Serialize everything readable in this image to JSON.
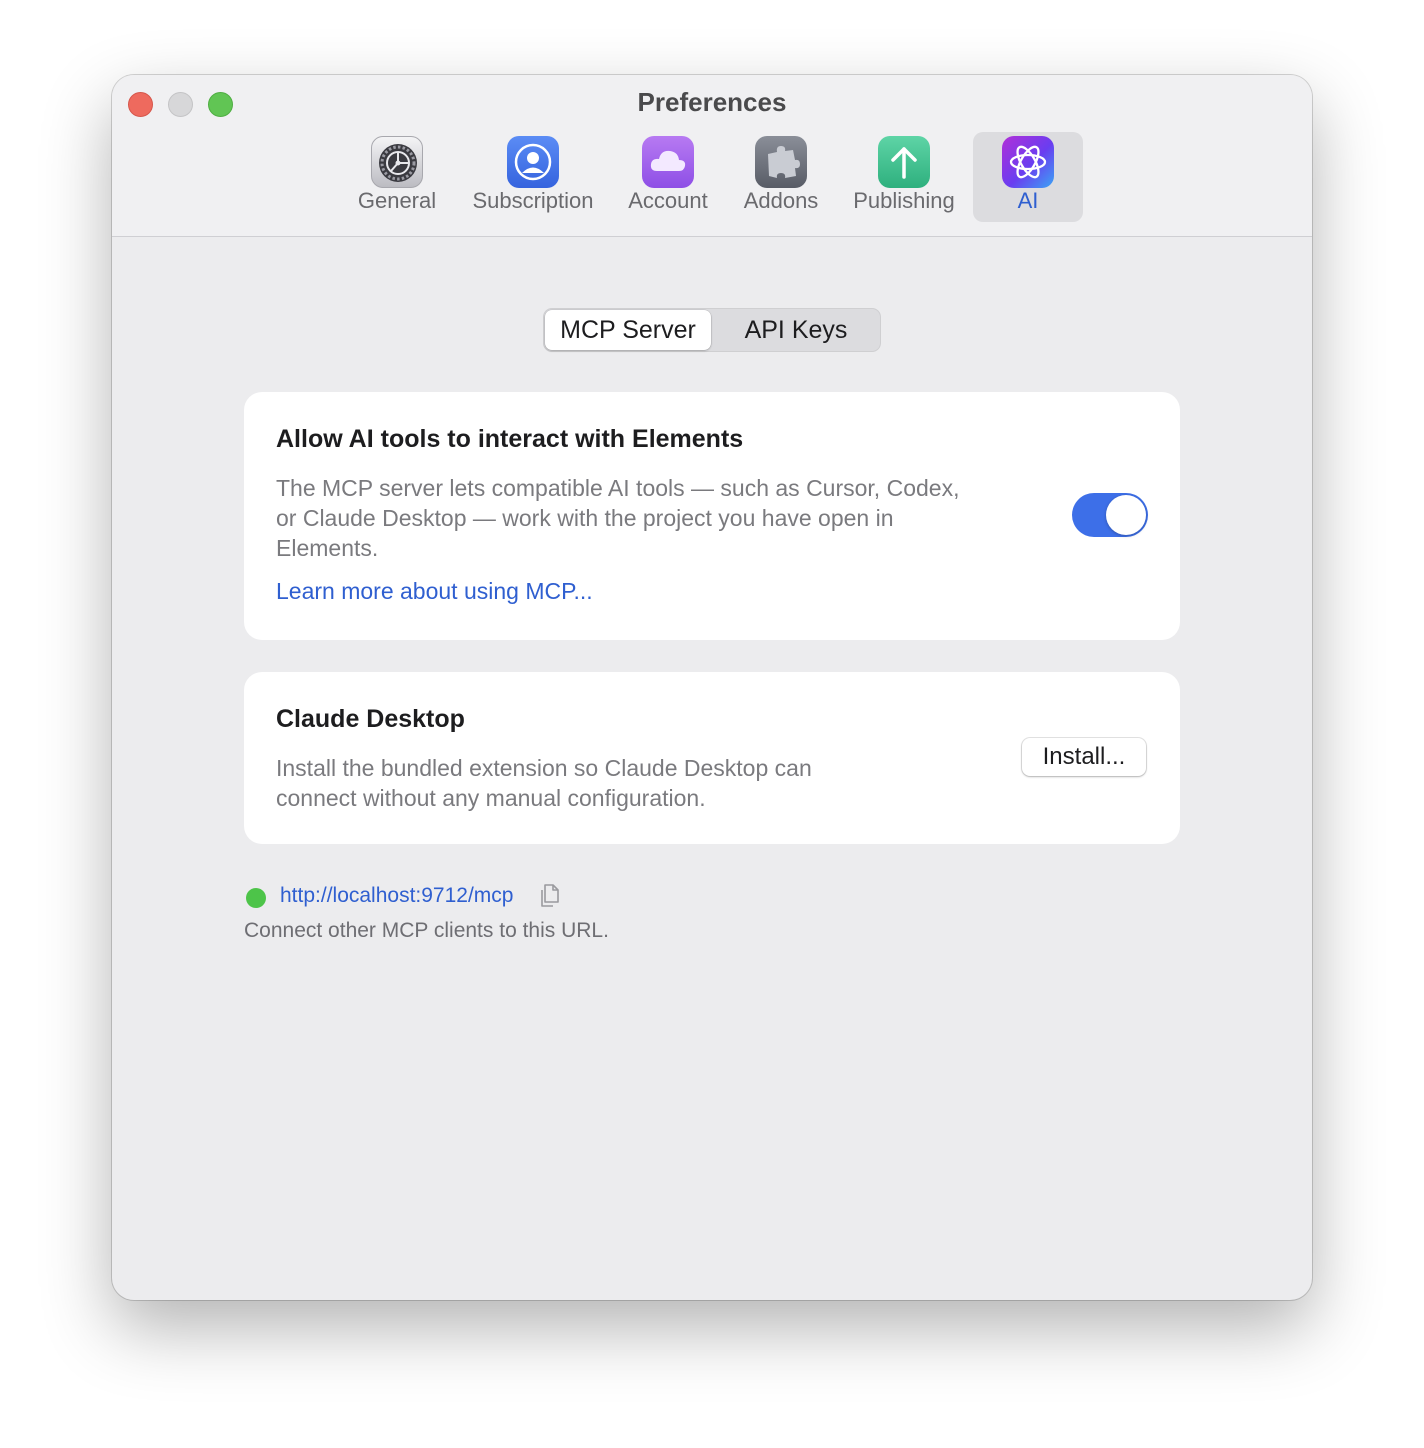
{
  "window": {
    "title": "Preferences"
  },
  "toolbar": {
    "items": [
      {
        "label": "General",
        "icon": "gear-icon"
      },
      {
        "label": "Subscription",
        "icon": "person-icon"
      },
      {
        "label": "Account",
        "icon": "cloud-icon"
      },
      {
        "label": "Addons",
        "icon": "puzzle-icon"
      },
      {
        "label": "Publishing",
        "icon": "upload-arrow-icon"
      },
      {
        "label": "AI",
        "icon": "atom-icon",
        "selected": true
      }
    ]
  },
  "segments": {
    "options": [
      "MCP Server",
      "API Keys"
    ],
    "selected": "MCP Server"
  },
  "mcp_card": {
    "title": "Allow AI tools to interact with Elements",
    "description": "The MCP server lets compatible AI tools — such as Cursor, Codex, or Claude Desktop — work with the project you have open in Elements.",
    "link": "Learn more about using MCP...",
    "toggle_on": true
  },
  "claude_card": {
    "title": "Claude Desktop",
    "description": "Install the bundled extension so Claude Desktop can connect without any manual configuration.",
    "button": "Install..."
  },
  "server": {
    "status_color": "#4dc449",
    "url": "http://localhost:9712/mcp",
    "caption": "Connect other MCP clients to this URL."
  },
  "colors": {
    "accent": "#3d6fe8",
    "link": "#2f5fd0"
  }
}
